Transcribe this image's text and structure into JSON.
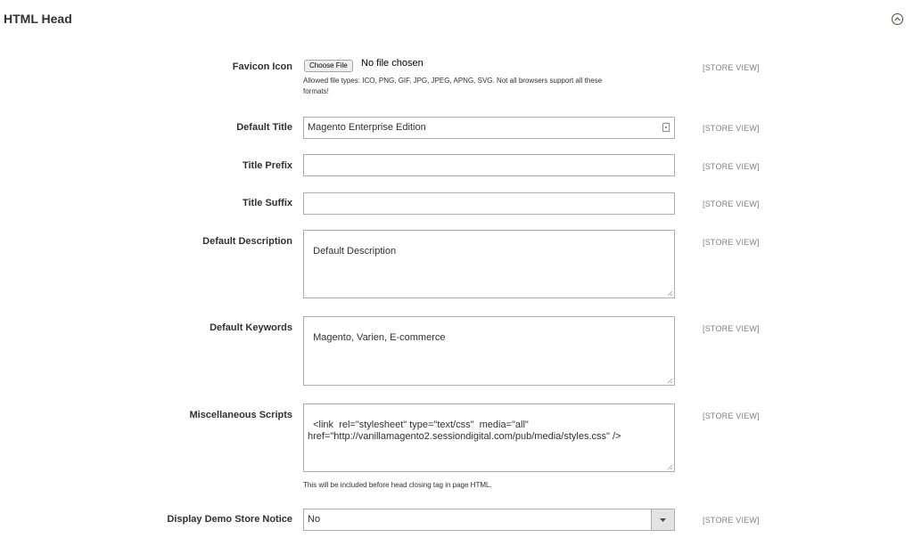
{
  "section": {
    "title": "HTML Head"
  },
  "fields": {
    "favicon": {
      "label": "Favicon Icon",
      "button_label": "Choose File",
      "status": "No file chosen",
      "note_line1": "Allowed file types: ICO, PNG, GIF, JPG, JPEG, APNG, SVG. Not all browsers support all these",
      "note_line2": "formats!",
      "scope": "[STORE VIEW]"
    },
    "default_title": {
      "label": "Default Title",
      "value": "Magento Enterprise Edition",
      "scope": "[STORE VIEW]"
    },
    "title_prefix": {
      "label": "Title Prefix",
      "value": "",
      "scope": "[STORE VIEW]"
    },
    "title_suffix": {
      "label": "Title Suffix",
      "value": "",
      "scope": "[STORE VIEW]"
    },
    "default_description": {
      "label": "Default Description",
      "value": "Default Description",
      "scope": "[STORE VIEW]"
    },
    "default_keywords": {
      "label": "Default Keywords",
      "value": "Magento, Varien, E-commerce",
      "scope": "[STORE VIEW]"
    },
    "misc_scripts": {
      "label": "Miscellaneous Scripts",
      "value": "<link  rel=\"stylesheet\" type=\"text/css\"  media=\"all\"\nhref=\"http://vanillamagento2.sessiondigital.com/pub/media/styles.css\" />",
      "note": "This will be included before head closing tag in page HTML.",
      "scope": "[STORE VIEW]"
    },
    "demo_notice": {
      "label": "Display Demo Store Notice",
      "value": "No",
      "scope": "[STORE VIEW]"
    }
  },
  "icons": {
    "collapse": "chevron-up-circle-icon",
    "select_arrow": "caret-down-icon",
    "title_field_icon": "contact-card-icon",
    "resize": "resize-grip-icon"
  }
}
